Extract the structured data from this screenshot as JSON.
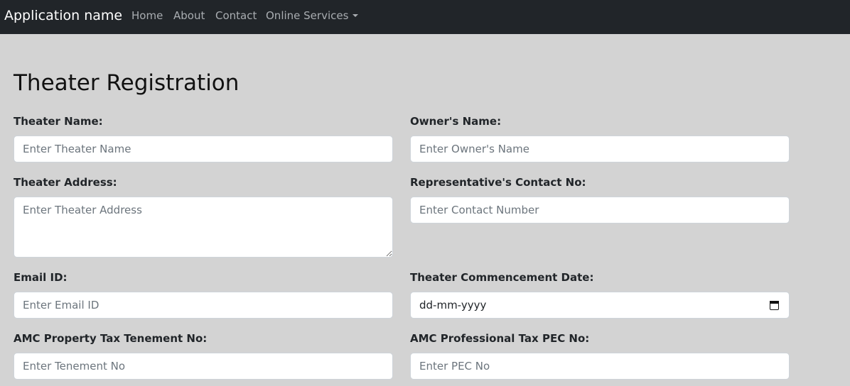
{
  "navbar": {
    "brand": "Application name",
    "links": [
      "Home",
      "About",
      "Contact",
      "Online Services"
    ]
  },
  "page": {
    "title": "Theater Registration"
  },
  "form": {
    "theater_name": {
      "label": "Theater Name:",
      "placeholder": "Enter Theater Name"
    },
    "owner_name": {
      "label": "Owner's Name:",
      "placeholder": "Enter Owner's Name"
    },
    "theater_address": {
      "label": "Theater Address:",
      "placeholder": "Enter Theater Address"
    },
    "contact_no": {
      "label": "Representative's Contact No:",
      "placeholder": "Enter Contact Number"
    },
    "email": {
      "label": "Email ID:",
      "placeholder": "Enter Email ID"
    },
    "commencement_date": {
      "label": "Theater Commencement Date:",
      "value": "dd-mm-yyyy"
    },
    "tenement_no": {
      "label": "AMC Property Tax Tenement No:",
      "placeholder": "Enter Tenement No"
    },
    "pec_no": {
      "label": "AMC Professional Tax PEC No:",
      "placeholder": "Enter PEC No"
    }
  },
  "icons": {
    "date_picker": "calendar-icon",
    "dropdown": "caret-down-icon"
  },
  "colors": {
    "navbar_bg": "#212529",
    "page_bg": "#d3d3d3",
    "nav_link": "#a9adb1"
  }
}
